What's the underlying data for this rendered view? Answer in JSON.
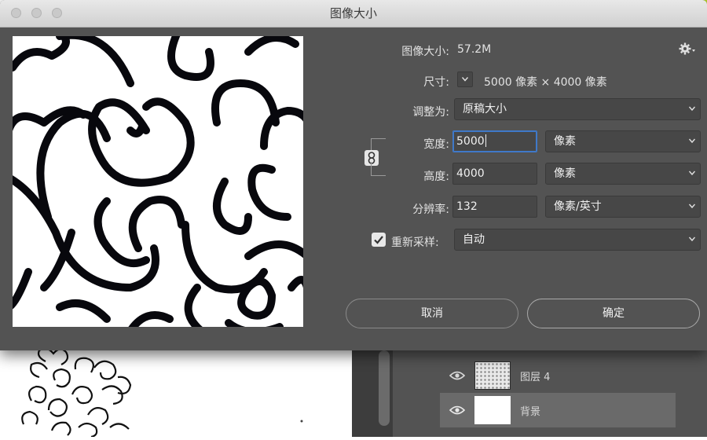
{
  "dialog": {
    "title": "图像大小",
    "image_size_label": "图像大小:",
    "image_size_value": "57.2M",
    "dimensions_label": "尺寸:",
    "dimensions_value": "5000 像素 × 4000 像素",
    "fit_to_label": "调整为:",
    "fit_to_value": "原稿大小",
    "width_label": "宽度:",
    "width_value": "5000",
    "width_unit": "像素",
    "height_label": "高度:",
    "height_value": "4000",
    "height_unit": "像素",
    "resolution_label": "分辨率:",
    "resolution_value": "132",
    "resolution_unit": "像素/英寸",
    "resample_label": "重新采样:",
    "resample_checked": true,
    "resample_value": "自动",
    "cancel_label": "取消",
    "ok_label": "确定",
    "icons": {
      "settings": "gear-icon",
      "constrain": "chain-link-icon",
      "dropdown": "chevron-down-icon"
    }
  },
  "layers_panel": {
    "layers": [
      {
        "name": "图层 4",
        "visible": true,
        "thumbnail": "pattern"
      },
      {
        "name": "背景",
        "visible": true,
        "thumbnail": "white",
        "selected": true
      }
    ]
  },
  "colors": {
    "dialog_bg": "#535353",
    "field_bg": "#474747",
    "focus": "#3f79c9",
    "accent": "#b6d62a"
  }
}
